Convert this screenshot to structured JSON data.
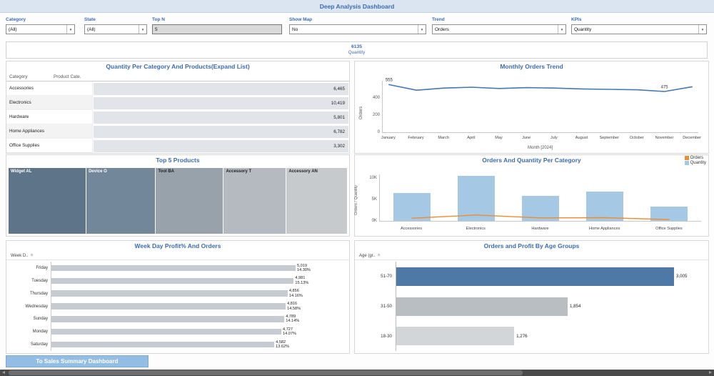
{
  "header": {
    "title": "Deep Analysis Dashboard"
  },
  "filters": [
    {
      "label": "Category",
      "value": "(All)",
      "type": "dropdown"
    },
    {
      "label": "State",
      "value": "(All)",
      "type": "dropdown"
    },
    {
      "label": "Top N",
      "value": "5",
      "type": "input"
    },
    {
      "label": "Show Map",
      "value": "No",
      "type": "dropdown"
    },
    {
      "label": "Trend",
      "value": "Orders",
      "type": "dropdown"
    },
    {
      "label": "KPIs",
      "value": "Quantity",
      "type": "dropdown"
    }
  ],
  "kpi": {
    "value": "6135",
    "label": "Quantity"
  },
  "footer": {
    "button_label": "To Sales Summary Dashboard"
  },
  "colors": {
    "accent_blue": "#3c6cb0",
    "trend_line_blue": "#4579b2",
    "quantity_bar_blue": "#a5c8e4",
    "orders_orange": "#ee8d30",
    "gray_bar": "#c5cbd1",
    "age_blue": "#4e79a7"
  },
  "chart_data": [
    {
      "id": "quantity-per-category",
      "type": "table",
      "title": "Quantity Per Category And Products(Expand List)",
      "columns": [
        "Category",
        "Product Cate."
      ],
      "band_color": "#e1e4e8",
      "rows": [
        {
          "category": "Accessories",
          "value": 6465,
          "value_label": "6,465"
        },
        {
          "category": "Electronics",
          "value": 10419,
          "value_label": "10,419"
        },
        {
          "category": "Hardware",
          "value": 5801,
          "value_label": "5,801"
        },
        {
          "category": "Home Appliances",
          "value": 6782,
          "value_label": "6,782"
        },
        {
          "category": "Office Supplies",
          "value": 3302,
          "value_label": "3,302"
        }
      ]
    },
    {
      "id": "monthly-orders-trend",
      "type": "line",
      "title": "Monthly Orders Trend",
      "x": [
        "January",
        "February",
        "March",
        "April",
        "May",
        "June",
        "July",
        "August",
        "September",
        "October",
        "November",
        "December"
      ],
      "values": [
        555,
        490,
        515,
        525,
        510,
        520,
        515,
        505,
        500,
        495,
        475,
        530
      ],
      "annotations": [
        {
          "x": "January",
          "label": "555"
        },
        {
          "x": "November",
          "label": "475"
        }
      ],
      "xlabel": "Month [2024]",
      "ylabel": "Orders",
      "yticks": [
        {
          "value": 0,
          "label": "0"
        },
        {
          "value": 200,
          "label": "200"
        },
        {
          "value": 400,
          "label": "400"
        }
      ],
      "ymax": 600,
      "line_color": "#4579b2"
    },
    {
      "id": "top-5-products",
      "type": "treemap",
      "title": "Top 5 Products",
      "items": [
        {
          "label": "Widget AL",
          "weight": 23,
          "color": "#5e7488",
          "text_color": "#ffffff"
        },
        {
          "label": "Device O",
          "weight": 20.5,
          "color": "#73879a",
          "text_color": "#ffffff"
        },
        {
          "label": "Tool BA",
          "weight": 20,
          "color": "#98a2ab",
          "text_color": "#222222"
        },
        {
          "label": "Accessory T",
          "weight": 18.5,
          "color": "#b4bac0",
          "text_color": "#222222"
        },
        {
          "label": "Accessory AN",
          "weight": 18,
          "color": "#c7cacd",
          "text_color": "#222222"
        }
      ]
    },
    {
      "id": "orders-quantity-per-category",
      "type": "combo",
      "title": "Orders And Quantity Per Category",
      "categories": [
        "Accessories",
        "Electronics",
        "Hardware",
        "Home Appliances",
        "Office Supplies"
      ],
      "series": [
        {
          "name": "Orders",
          "type": "line",
          "color": "#ee8d30",
          "values": [
            620,
            1370,
            700,
            740,
            300
          ]
        },
        {
          "name": "Quantity",
          "type": "bar",
          "color": "#a5c8e4",
          "values": [
            6465,
            10419,
            5801,
            6782,
            3302
          ]
        }
      ],
      "ylabel": "Orders / Quantity",
      "yticks": [
        {
          "value": 0,
          "label": "0K"
        },
        {
          "value": 5000,
          "label": "5K"
        },
        {
          "value": 10000,
          "label": "10K"
        }
      ],
      "ymax": 10800,
      "legend": [
        "Orders",
        "Quantity"
      ]
    },
    {
      "id": "weekday-profit-orders",
      "type": "bar",
      "title": "Week Day Profit% And Orders",
      "axis_header": "Week D..",
      "bar_color": "#c5cbd1",
      "xmax": 5019,
      "rows": [
        {
          "label": "Friday",
          "value": 5019,
          "value_label": "5,019",
          "pct_label": "14.30%"
        },
        {
          "label": "Tuesday",
          "value": 4981,
          "value_label": "4,981",
          "pct_label": "15.13%"
        },
        {
          "label": "Thursday",
          "value": 4856,
          "value_label": "4,856",
          "pct_label": "14.16%"
        },
        {
          "label": "Wednesday",
          "value": 4816,
          "value_label": "4,816",
          "pct_label": "14.58%"
        },
        {
          "label": "Sunday",
          "value": 4789,
          "value_label": "4,789",
          "pct_label": "14.14%"
        },
        {
          "label": "Monday",
          "value": 4727,
          "value_label": "4,727",
          "pct_label": "14.07%"
        },
        {
          "label": "Saturday",
          "value": 4582,
          "value_label": "4,582",
          "pct_label": "13.62%"
        }
      ]
    },
    {
      "id": "orders-profit-age-groups",
      "type": "bar",
      "title": "Orders and Profit By Age Groups",
      "axis_header": "Age (gr..",
      "xmax": 3005,
      "rows": [
        {
          "label": "51-70",
          "value": 3005,
          "value_label": "3,005",
          "color": "#4e79a7"
        },
        {
          "label": "31-50",
          "value": 1854,
          "value_label": "1,854",
          "color": "#b9bec3"
        },
        {
          "label": "18-30",
          "value": 1276,
          "value_label": "1,276",
          "color": "#d3d6d8"
        }
      ]
    }
  ]
}
